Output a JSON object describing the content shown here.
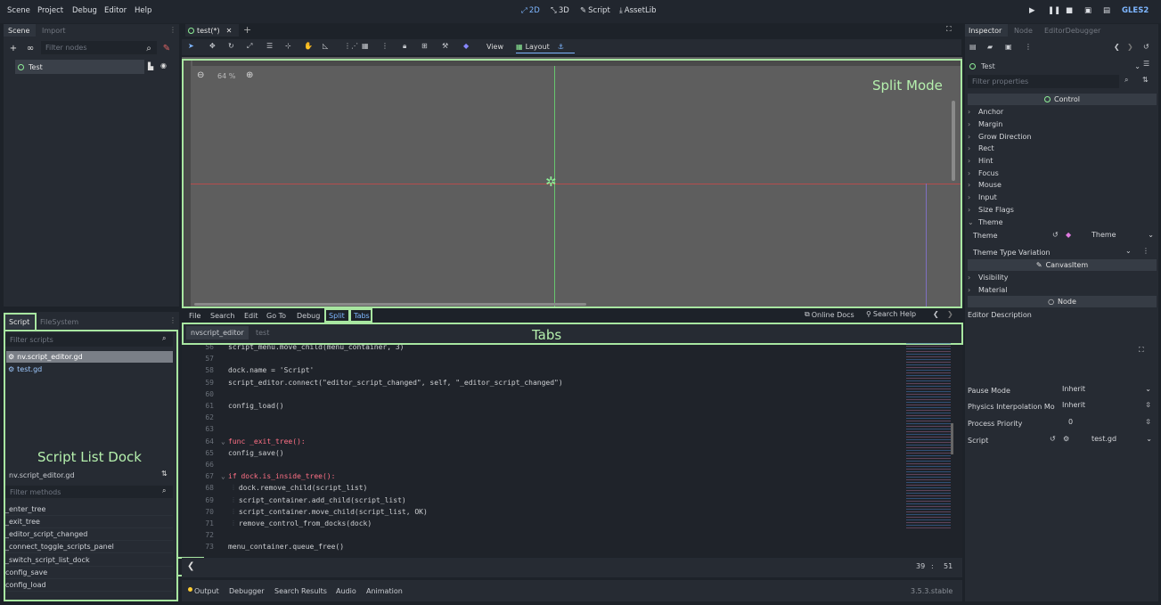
{
  "menu": {
    "items": [
      "Scene",
      "Project",
      "Debug",
      "Editor",
      "Help"
    ]
  },
  "workspaces": {
    "2d": "2D",
    "3d": "3D",
    "script": "Script",
    "assetlib": "AssetLib"
  },
  "renderer": "GLES2",
  "scene_dock": {
    "tabs": [
      "Scene",
      "Import"
    ],
    "filter_placeholder": "Filter nodes",
    "root_node": "Test"
  },
  "editor_tab": {
    "name": "test(*)"
  },
  "canvas_toolbar": {
    "view": "View",
    "layout": "Layout"
  },
  "viewport": {
    "zoom": "64 %"
  },
  "annotations": {
    "split_mode": "Split Mode",
    "tabs": "Tabs",
    "script_list_dock": "Script List Dock"
  },
  "script_dock": {
    "tabs": [
      "Script",
      "FileSystem"
    ],
    "filter_scripts": "Filter scripts",
    "scripts": [
      "nv.script_editor.gd",
      "test.gd"
    ],
    "current_script": "nv.script_editor.gd",
    "filter_methods": "Filter methods",
    "methods": [
      "_enter_tree",
      "_exit_tree",
      "_editor_script_changed",
      "_connect_toggle_scripts_panel",
      "_switch_script_list_dock",
      "config_save",
      "config_load"
    ]
  },
  "script_menu": {
    "items": [
      "File",
      "Search",
      "Edit",
      "Go To",
      "Debug",
      "Split",
      "Tabs"
    ],
    "online_docs": "Online Docs",
    "search_help": "Search Help"
  },
  "script_tabs": [
    "nvscript_editor",
    "test"
  ],
  "code": [
    {
      "n": "56",
      "t": "script_menu.move_child(menu_container, 3)"
    },
    {
      "n": "57",
      "t": ""
    },
    {
      "n": "58",
      "t": "dock.name = 'Script'"
    },
    {
      "n": "59",
      "t": "script_editor.connect(\"editor_script_changed\", self, \"_editor_script_changed\")"
    },
    {
      "n": "60",
      "t": ""
    },
    {
      "n": "61",
      "t": "config_load()"
    },
    {
      "n": "62",
      "t": ""
    },
    {
      "n": "63",
      "t": ""
    },
    {
      "n": "64",
      "t": "func _exit_tree():"
    },
    {
      "n": "65",
      "t": "config_save()"
    },
    {
      "n": "66",
      "t": ""
    },
    {
      "n": "67",
      "t": "if dock.is_inside_tree():"
    },
    {
      "n": "68",
      "t": "dock.remove_child(script_list)"
    },
    {
      "n": "69",
      "t": "script_container.add_child(script_list)"
    },
    {
      "n": "70",
      "t": "script_container.move_child(script_list, OK)"
    },
    {
      "n": "71",
      "t": "remove_control_from_docks(dock)"
    },
    {
      "n": "72",
      "t": ""
    },
    {
      "n": "73",
      "t": "menu_container.queue_free()"
    }
  ],
  "cursor": {
    "line": "39",
    "sep": ":",
    "col": "51"
  },
  "bottom_panel": {
    "tabs": [
      "Output",
      "Debugger",
      "Search Results",
      "Audio",
      "Animation"
    ],
    "version": "3.5.3.stable"
  },
  "inspector": {
    "tabs": [
      "Inspector",
      "Node",
      "EditorDebugger"
    ],
    "node_name": "Test",
    "filter_placeholder": "Filter properties",
    "control_header": "Control",
    "groups": [
      "Anchor",
      "Margin",
      "Grow Direction",
      "Rect",
      "Hint",
      "Focus",
      "Mouse",
      "Input",
      "Size Flags",
      "Theme"
    ],
    "theme_label": "Theme",
    "theme_value": "Theme",
    "theme_type_variation": "Theme Type Variation",
    "canvasitem_header": "CanvasItem",
    "canvas_groups": [
      "Visibility",
      "Material"
    ],
    "node_header": "Node",
    "editor_description": "Editor Description",
    "pause_mode_label": "Pause Mode",
    "pause_mode_value": "Inherit",
    "physics_interp_label": "Physics Interpolation Mo",
    "physics_interp_value": "Inherit",
    "process_priority_label": "Process Priority",
    "process_priority_value": "0",
    "script_label": "Script",
    "script_value": "test.gd"
  },
  "colors": {
    "accent": "#7eb6ff",
    "annotation": "#a8e6a1",
    "keyword": "#ff7085",
    "function": "#66e6ff",
    "string": "#ffeda1",
    "node_green": "#8eef97"
  }
}
